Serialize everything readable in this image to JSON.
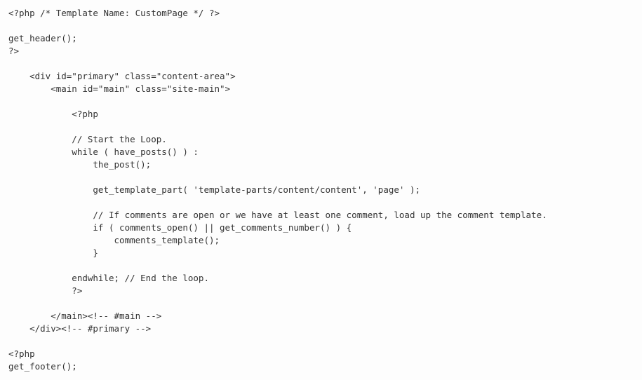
{
  "code": {
    "lines": [
      "<?php /* Template Name: CustomPage */ ?>",
      "",
      "get_header();",
      "?>",
      "",
      "    <div id=\"primary\" class=\"content-area\">",
      "        <main id=\"main\" class=\"site-main\">",
      "",
      "            <?php",
      "",
      "            // Start the Loop.",
      "            while ( have_posts() ) :",
      "                the_post();",
      "",
      "                get_template_part( 'template-parts/content/content', 'page' );",
      "",
      "                // If comments are open or we have at least one comment, load up the comment template.",
      "                if ( comments_open() || get_comments_number() ) {",
      "                    comments_template();",
      "                }",
      "",
      "            endwhile; // End the loop.",
      "            ?>",
      "",
      "        </main><!-- #main -->",
      "    </div><!-- #primary -->",
      "",
      "<?php",
      "get_footer();"
    ]
  }
}
